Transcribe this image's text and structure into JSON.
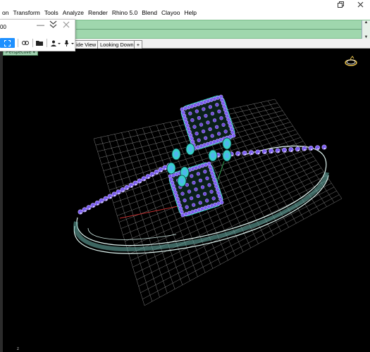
{
  "menu": {
    "items": [
      "on",
      "Transform",
      "Tools",
      "Analyze",
      "Render",
      "Rhino 5.0",
      "Blend",
      "Clayoo",
      "Help"
    ]
  },
  "window": {
    "restore_icon": "restore-icon",
    "close_icon": "close-icon"
  },
  "dialog": {
    "title": "00",
    "minimize_icon": "minimize-icon",
    "collapse_icon": "double-chevron-down-icon",
    "close_icon": "close-icon",
    "toolbar_icons": [
      "fullscreen-icon",
      "link-icon",
      "folder-icon",
      "person-icon",
      "microphone-icon"
    ]
  },
  "tabs": [
    {
      "label": "ide View"
    },
    {
      "label": "Looking Down"
    },
    {
      "label": "+"
    }
  ],
  "viewport": {
    "label": "Perspective",
    "axis_label": "z",
    "background": "#000000",
    "grid_color": "#a9a9a9",
    "gem_color": "#7a5cf0",
    "metal_color": "#6fb9b0",
    "highlight_color": "#39d0c8"
  }
}
